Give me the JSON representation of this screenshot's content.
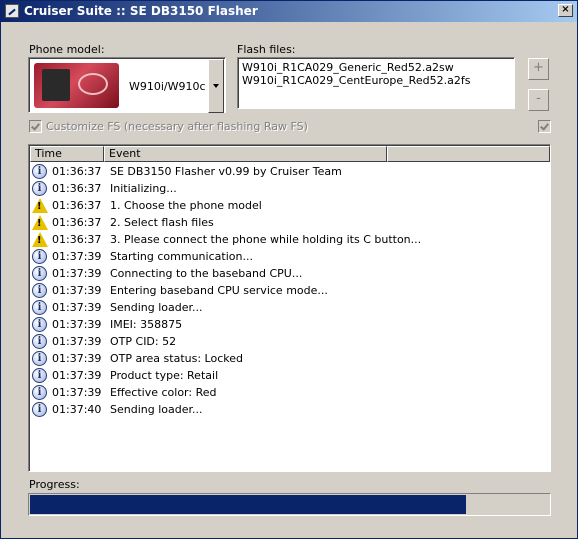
{
  "window": {
    "title": "Cruiser Suite :: SE DB3150 Flasher",
    "close_label": "×"
  },
  "phone": {
    "label": "Phone model:",
    "selected": "W910i/W910c"
  },
  "flash": {
    "label": "Flash files:",
    "files": [
      "W910i_R1CA029_Generic_Red52.a2sw",
      "W910i_R1CA029_CentEurope_Red52.a2fs"
    ],
    "add_label": "+",
    "remove_label": "-"
  },
  "customize": {
    "label": "Customize FS (necessary after flashing Raw FS)"
  },
  "log": {
    "columns": [
      "Time",
      "Event"
    ],
    "rows": [
      {
        "icon": "info-icon",
        "time": "01:36:37",
        "event": "SE DB3150 Flasher v0.99 by Cruiser Team"
      },
      {
        "icon": "info-icon",
        "time": "01:36:37",
        "event": "Initializing..."
      },
      {
        "icon": "warning-icon",
        "time": "01:36:37",
        "event": "1. Choose the phone model"
      },
      {
        "icon": "warning-icon",
        "time": "01:36:37",
        "event": "2. Select flash files"
      },
      {
        "icon": "warning-icon",
        "time": "01:36:37",
        "event": "3. Please connect the phone while holding its C button..."
      },
      {
        "icon": "info-icon",
        "time": "01:37:39",
        "event": "Starting communication..."
      },
      {
        "icon": "info-icon",
        "time": "01:37:39",
        "event": "Connecting to the baseband CPU..."
      },
      {
        "icon": "info-icon",
        "time": "01:37:39",
        "event": "Entering baseband CPU service mode..."
      },
      {
        "icon": "info-icon",
        "time": "01:37:39",
        "event": "Sending loader..."
      },
      {
        "icon": "info-icon",
        "time": "01:37:39",
        "event": "IMEI: 358875"
      },
      {
        "icon": "info-icon",
        "time": "01:37:39",
        "event": "OTP CID: 52"
      },
      {
        "icon": "info-icon",
        "time": "01:37:39",
        "event": "OTP area status: Locked"
      },
      {
        "icon": "info-icon",
        "time": "01:37:39",
        "event": "Product type: Retail"
      },
      {
        "icon": "info-icon",
        "time": "01:37:39",
        "event": "Effective color: Red"
      },
      {
        "icon": "info-icon",
        "time": "01:37:40",
        "event": "Sending loader..."
      }
    ]
  },
  "progress": {
    "label": "Progress:",
    "fraction": 0.84
  },
  "colors": {
    "title_start": "#0a246a",
    "title_end": "#a6caf0",
    "progress": "#0a246a",
    "warning": "#e8c000"
  }
}
